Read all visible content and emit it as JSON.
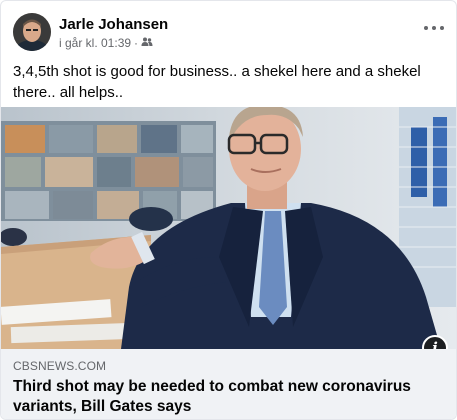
{
  "post": {
    "author": "Jarle Johansen",
    "timestamp": "i går kl. 01:39",
    "separator": "·",
    "audience_icon": "friends-icon",
    "text": "3,4,5th shot is good for business.. a shekel here and a shekel there.. all helps.."
  },
  "link": {
    "domain": "CBSNEWS.COM",
    "headline": "Third shot may be needed to combat new coronavirus variants, Bill Gates says",
    "info_label": "i"
  },
  "colors": {
    "text_primary": "#050505",
    "text_secondary": "#65676b",
    "link_background": "#f0f2f5"
  }
}
